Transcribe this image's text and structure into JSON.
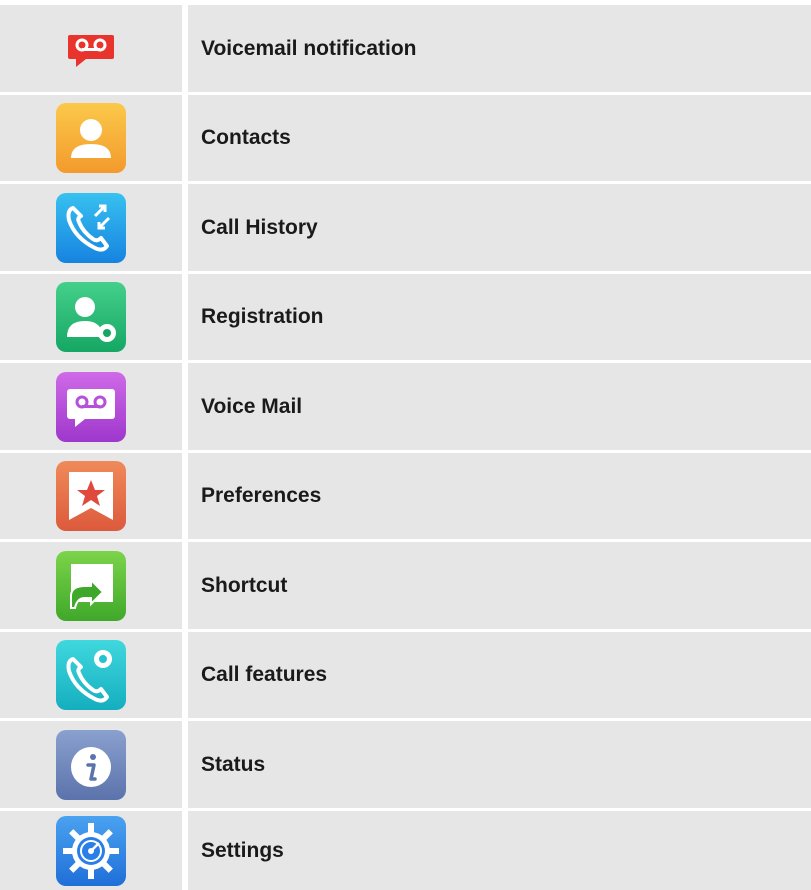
{
  "menu": {
    "items": [
      {
        "icon": "voicemail-notification-icon",
        "label": "Voicemail notification"
      },
      {
        "icon": "contacts-icon",
        "label": "Contacts"
      },
      {
        "icon": "call-history-icon",
        "label": "Call History"
      },
      {
        "icon": "registration-icon",
        "label": "Registration"
      },
      {
        "icon": "voice-mail-icon",
        "label": "Voice Mail"
      },
      {
        "icon": "preferences-icon",
        "label": "Preferences"
      },
      {
        "icon": "shortcut-icon",
        "label": "Shortcut"
      },
      {
        "icon": "call-features-icon",
        "label": "Call features"
      },
      {
        "icon": "status-icon",
        "label": "Status"
      },
      {
        "icon": "settings-icon",
        "label": "Settings"
      }
    ]
  },
  "colors": {
    "row_background": "#e6e6e6",
    "voicemail_notification": "#e8342c",
    "contacts": "#f6a93a",
    "call_history": "#1e9be6",
    "registration": "#2fbf7a",
    "voice_mail": "#b64fd9",
    "preferences": "#e56a4c",
    "shortcut": "#5cbf35",
    "call_features": "#23c3cf",
    "status": "#6f86bb",
    "settings": "#2a7fe6"
  }
}
